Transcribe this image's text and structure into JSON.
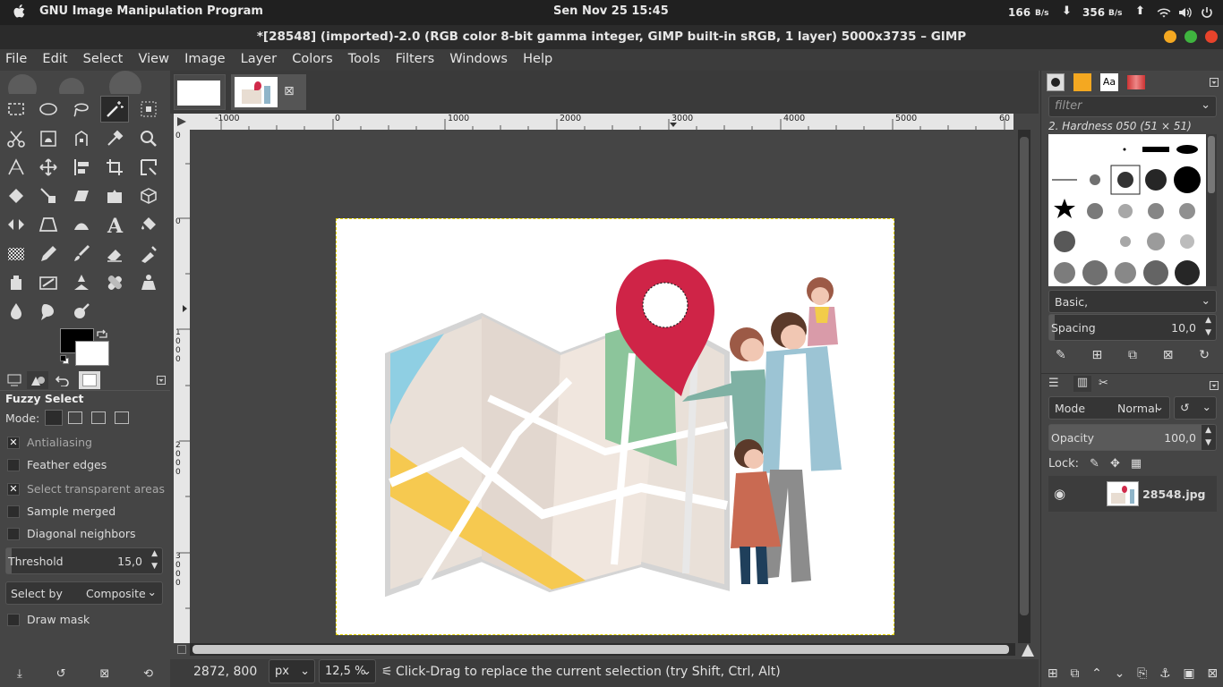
{
  "system_bar": {
    "app_name": "GNU Image Manipulation Program",
    "clock": "Sen Nov 25  15:45",
    "net_down": "166",
    "net_down_unit": "B/s",
    "net_up": "356",
    "net_up_unit": "B/s"
  },
  "window": {
    "title": "*[28548] (imported)-2.0 (RGB color 8-bit gamma integer, GIMP built-in sRGB, 1 layer) 5000x3735 – GIMP"
  },
  "menu": [
    "File",
    "Edit",
    "Select",
    "View",
    "Image",
    "Layer",
    "Colors",
    "Tools",
    "Filters",
    "Windows",
    "Help"
  ],
  "tool_options": {
    "title": "Fuzzy Select",
    "mode_label": "Mode:",
    "antialiasing": "Antialiasing",
    "feather_edges": "Feather edges",
    "select_transparent": "Select transparent areas",
    "sample_merged": "Sample merged",
    "diagonal_neighbors": "Diagonal neighbors",
    "threshold_label": "Threshold",
    "threshold_value": "15,0",
    "select_by_label": "Select by",
    "select_by_value": "Composite",
    "draw_mask": "Draw mask"
  },
  "rulers": {
    "h_labels": [
      "-1000",
      "0",
      "1000",
      "2000",
      "3000",
      "4000",
      "5000",
      "60"
    ],
    "v_labels": [
      "0",
      "0",
      "1000",
      "2000",
      "3000"
    ]
  },
  "status": {
    "coords": "2872, 800",
    "unit": "px",
    "zoom": "12,5 %",
    "message": "Click-Drag to replace the current selection (try Shift, Ctrl, Alt)"
  },
  "brushes": {
    "filter_placeholder": "filter",
    "selected_brush": "2. Hardness 050 (51 × 51)",
    "preset": "Basic,",
    "spacing_label": "Spacing",
    "spacing_value": "10,0"
  },
  "layers": {
    "mode_label": "Mode",
    "mode_value": "Normal",
    "opacity_label": "Opacity",
    "opacity_value": "100,0",
    "lock_label": "Lock:",
    "layer_name": "28548.jpg"
  }
}
